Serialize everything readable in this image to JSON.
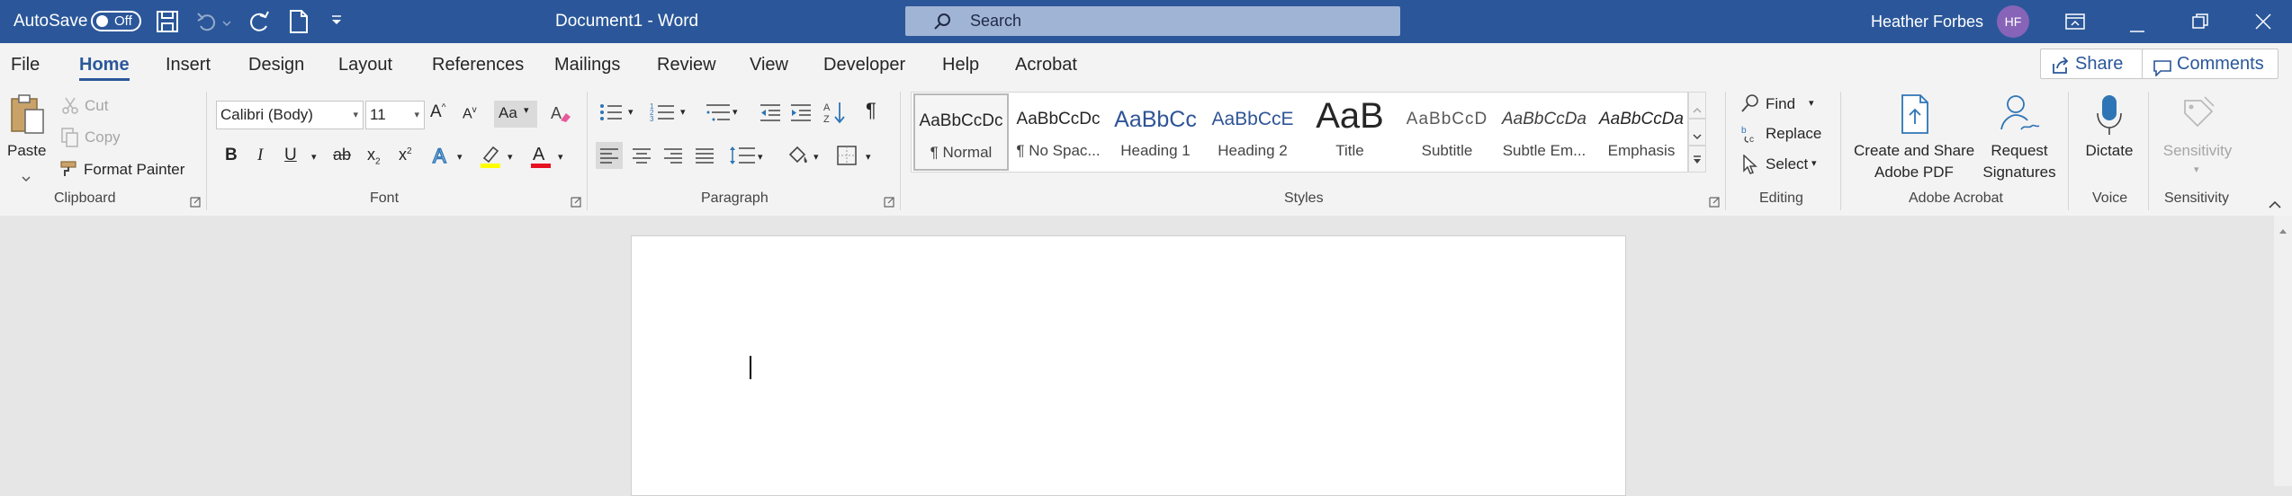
{
  "titlebar": {
    "autosave_label": "AutoSave",
    "autosave_state": "Off",
    "doc_title": "Document1  -  Word",
    "search_placeholder": "Search",
    "user_name": "Heather Forbes",
    "user_initials": "HF",
    "icons": [
      "save-icon",
      "undo-icon",
      "redo-icon",
      "new-document-icon",
      "customize-qat-icon",
      "ribbon-display-options-icon",
      "minimize-icon",
      "restore-icon",
      "close-icon"
    ]
  },
  "tabs": {
    "items": [
      "File",
      "Home",
      "Insert",
      "Design",
      "Layout",
      "References",
      "Mailings",
      "Review",
      "View",
      "Developer",
      "Help",
      "Acrobat"
    ],
    "active": "Home",
    "share_label": "Share",
    "comments_label": "Comments"
  },
  "ribbon": {
    "clipboard": {
      "paste": "Paste",
      "cut": "Cut",
      "copy": "Copy",
      "format_painter": "Format Painter",
      "group": "Clipboard"
    },
    "font": {
      "font_name": "Calibri (Body)",
      "font_size": "11",
      "change_case": "Aa",
      "group": "Font"
    },
    "paragraph": {
      "group": "Paragraph"
    },
    "styles": {
      "items": [
        {
          "preview": "AaBbCcDc",
          "name": "¶ Normal"
        },
        {
          "preview": "AaBbCcDc",
          "name": "¶ No Spac..."
        },
        {
          "preview": "AaBbCc",
          "name": "Heading 1"
        },
        {
          "preview": "AaBbCcE",
          "name": "Heading 2"
        },
        {
          "preview": "AaB",
          "name": "Title"
        },
        {
          "preview": "AaBbCcD",
          "name": "Subtitle"
        },
        {
          "preview": "AaBbCcDa",
          "name": "Subtle Em..."
        },
        {
          "preview": "AaBbCcDa",
          "name": "Emphasis"
        }
      ],
      "group": "Styles"
    },
    "editing": {
      "find": "Find",
      "replace": "Replace",
      "select": "Select",
      "group": "Editing"
    },
    "acrobat": {
      "create_share_line1": "Create and Share",
      "create_share_line2": "Adobe PDF",
      "request_line1": "Request",
      "request_line2": "Signatures",
      "group": "Adobe Acrobat"
    },
    "voice": {
      "dictate": "Dictate",
      "group": "Voice"
    },
    "sensitivity": {
      "label": "Sensitivity",
      "group": "Sensitivity"
    }
  },
  "colors": {
    "titlebar_bg": "#2b579a",
    "ribbon_bg": "#f3f3f3",
    "accent": "#2b579a",
    "highlight_yellow": "#ffff00",
    "font_color_red": "#e81123",
    "avatar_bg": "#8764b8",
    "canvas_bg": "#e6e6e6"
  }
}
